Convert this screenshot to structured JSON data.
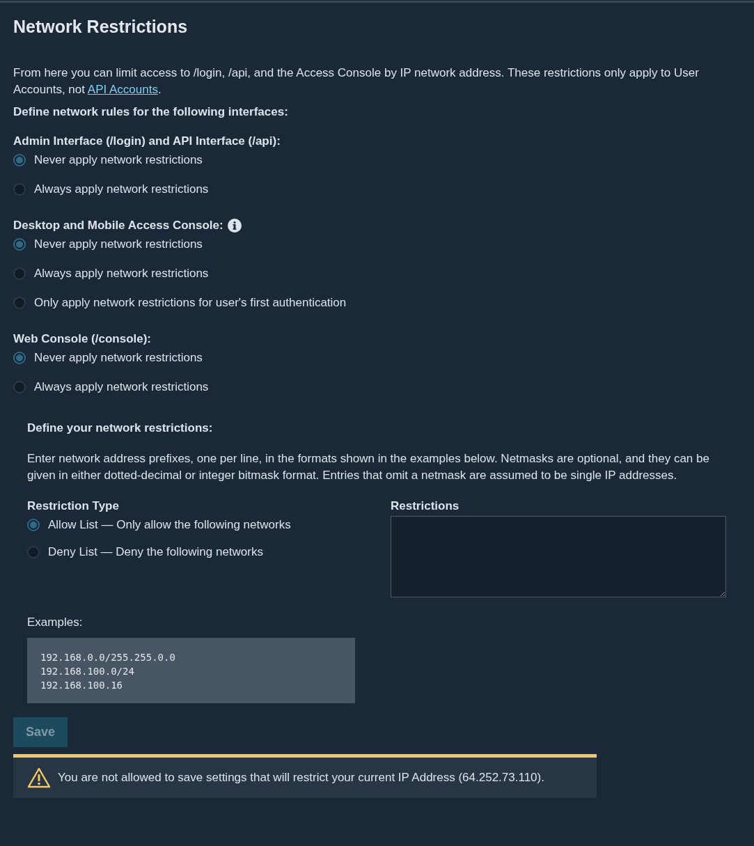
{
  "title": "Network Restrictions",
  "intro": {
    "before": "From here you can limit access to /login, /api, and the Access Console by IP network address. These restrictions only apply to User Accounts, not ",
    "link": "API Accounts",
    "after": "."
  },
  "rules_heading": "Define network rules for the following interfaces:",
  "groups": [
    {
      "label": "Admin Interface (/login) and API Interface (/api):",
      "info": false,
      "options": [
        {
          "label": "Never apply network restrictions",
          "selected": true
        },
        {
          "label": "Always apply network restrictions",
          "selected": false
        }
      ]
    },
    {
      "label": "Desktop and Mobile Access Console:",
      "info": true,
      "options": [
        {
          "label": "Never apply network restrictions",
          "selected": true
        },
        {
          "label": "Always apply network restrictions",
          "selected": false
        },
        {
          "label": "Only apply network restrictions for user's first authentication",
          "selected": false
        }
      ]
    },
    {
      "label": "Web Console (/console):",
      "info": false,
      "options": [
        {
          "label": "Never apply network restrictions",
          "selected": true
        },
        {
          "label": "Always apply network restrictions",
          "selected": false
        }
      ]
    }
  ],
  "restrictions_section": {
    "heading": "Define your network restrictions:",
    "description": "Enter network address prefixes, one per line, in the formats shown in the examples below. Netmasks are optional, and they can be given in either dotted-decimal or integer bitmask format. Entries that omit a netmask are assumed to be single IP addresses.",
    "type_label": "Restriction Type",
    "types": [
      {
        "label": "Allow List — Only allow the following networks",
        "selected": true
      },
      {
        "label": "Deny List — Deny the following networks",
        "selected": false
      }
    ],
    "restrictions_label": "Restrictions",
    "examples_label": "Examples:",
    "examples": [
      "192.168.0.0/255.255.0.0",
      "192.168.100.0/24",
      "192.168.100.16"
    ]
  },
  "save_button": {
    "label": "Save",
    "disabled": true
  },
  "warning": "You are not allowed to save settings that will restrict your current IP Address (64.252.73.110)."
}
